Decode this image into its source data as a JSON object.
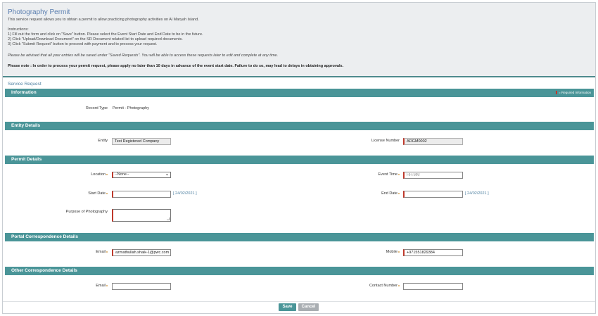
{
  "header": {
    "title": "Photography Permit",
    "intro": "This service request allows you to obtain a permit to allow practicing photography activities on Al Maryah Island.",
    "instructions_heading": "Instructions:",
    "steps": [
      "1) Fill out the form and click on \"Save\" button. Please select the Event Start Date and End Date to be in the future.",
      "2) Click \"Upload/Download Document\" on the SR Document related list to upload required documents.",
      "3) Click \"Submit Request\" button to proceed with payment and to process your request."
    ],
    "advice": "Please be advised that all your entries will be saved under \"Saved Requests\". You will be able to access these requests later to edit and complete at any time.",
    "note": "Please note : In order to process your permit request, please apply no later than 10 days in advance of the event start date. Failure to do so, may lead to delays in obtaining approvals."
  },
  "service_request_label": "Service Request",
  "required_info": "= Required Information",
  "sections": {
    "information": {
      "title": "Information",
      "record_type_label": "Record Type",
      "record_type_value": "Permit - Photography"
    },
    "entity": {
      "title": "Entity Details",
      "entity_label": "Entity",
      "entity_value": "Test Registered Company",
      "license_label": "License Number",
      "license_value": "ADGM0002"
    },
    "permit": {
      "title": "Permit Details",
      "location_label": "Location",
      "location_value": "--None--",
      "event_time_label": "Event Time",
      "event_time_placeholder": "HH:MM",
      "start_date_label": "Start Date",
      "start_date_link": "[ 24/02/2021 ]",
      "end_date_label": "End Date",
      "end_date_link": "[ 24/02/2021 ]",
      "purpose_label": "Purpose of Photography"
    },
    "portal": {
      "title": "Portal Correspondence Details",
      "email_label": "Email",
      "email_value": "azmathullah.shaik-1@pwc.com",
      "mobile_label": "Mobile",
      "mobile_value": "+971551829384"
    },
    "other": {
      "title": "Other Correspondence Details",
      "email_label": "Email",
      "contact_label": "Contact Number"
    }
  },
  "buttons": {
    "save": "Save",
    "cancel": "Cancel"
  },
  "colors": {
    "section_bar": "#4a9598",
    "title_blue": "#5b7fb0",
    "required_red": "#c0392b"
  }
}
